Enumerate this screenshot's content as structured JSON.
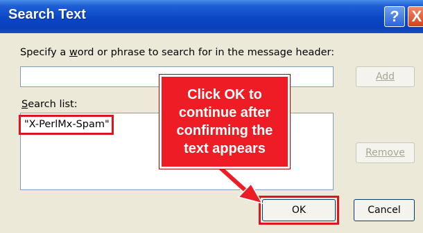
{
  "window": {
    "title": "Search Text",
    "help_glyph": "?",
    "close_glyph": "X"
  },
  "dialog": {
    "instruction_prefix": "Specify a ",
    "instruction_underline": "w",
    "instruction_suffix": "ord or phrase to search for in the message header:",
    "search_input_value": "",
    "add_label": "Add",
    "search_list_label_underline": "S",
    "search_list_label_rest": "earch list:",
    "search_list_items": [
      "\"X-PerlMx-Spam\""
    ],
    "remove_label": "Remove",
    "ok_label": "OK",
    "cancel_label": "Cancel"
  },
  "annotation": {
    "callout_text": "Click OK to\ncontinue after\nconfirming the\ntext appears",
    "highlight_color": "#e0141e",
    "callout_color": "#ee1c25"
  }
}
